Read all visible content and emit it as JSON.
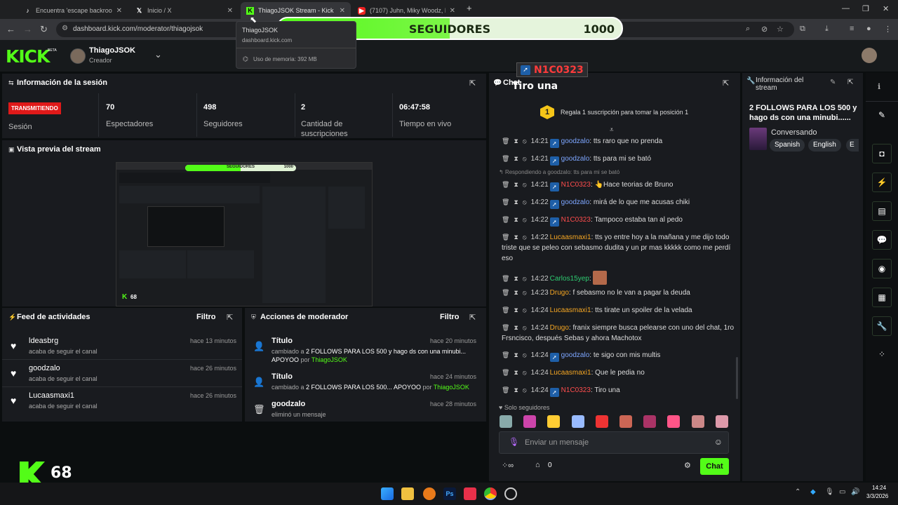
{
  "browser": {
    "tabs": [
      {
        "title": "Encuentra 'escape backrooms' e",
        "icon": "tiktok-icon"
      },
      {
        "title": "Inicio / X",
        "icon": "x-icon"
      },
      {
        "title": "ThiagoJSOK Stream - Kick Dash",
        "icon": "kick-icon"
      },
      {
        "title": "(7107) Juhn, Miky Woodz, B",
        "icon": "youtube-icon"
      }
    ],
    "new_tab": "+",
    "url": "dashboard.kick.com/moderator/thiagojsok",
    "tooltip": {
      "title": "ThiagoJSOK",
      "host": "dashboard.kick.com",
      "memory": "Uso de memoria: 392 MB"
    }
  },
  "follower_goal": {
    "current": "499",
    "label": "SEGUIDORES",
    "goal": "1000",
    "progress": 0.499
  },
  "header": {
    "logo": "KICK",
    "beta": "BETA",
    "username": "ThiagoJSOK",
    "role": "Creador"
  },
  "session": {
    "title": "Información de la sesión",
    "status": "TRANSMITIENDO",
    "status_label": "Sesión",
    "stats": [
      {
        "value": "70",
        "label": "Espectadores"
      },
      {
        "value": "498",
        "label": "Seguidores"
      },
      {
        "value": "2",
        "label": "Cantidad de suscripciones"
      },
      {
        "value": "06:47:58",
        "label": "Tiempo en vivo"
      }
    ]
  },
  "preview": {
    "title": "Vista previa del stream",
    "progress_label": "SEGUIDORES",
    "progress_goal": "1000",
    "logo_text": "68"
  },
  "feed": {
    "title": "Feed de actividades",
    "filter": "Filtro",
    "items": [
      {
        "name": "ldeasbrg",
        "action": "acaba de seguir el canal",
        "time": "hace 13 minutos"
      },
      {
        "name": "goodzalo",
        "action": "acaba de seguir el canal",
        "time": "hace 26 minutos"
      },
      {
        "name": "Lucaasmaxi1",
        "action": "acaba de seguir el canal",
        "time": "hace 26 minutos"
      }
    ]
  },
  "mod": {
    "title": "Acciones de moderador",
    "filter": "Filtro",
    "items": [
      {
        "title": "Título",
        "time": "hace 20 minutos",
        "pre": "cambiado a ",
        "value": "2 FOLLOWS PARA LOS 500 y hago ds con una minubi...",
        "mid": "APOYOO",
        "by": " por ",
        "user": "ThiagoJSOK"
      },
      {
        "title": "Título",
        "time": "hace 24 minutos",
        "pre": "cambiado a ",
        "value": "2 FOLLOWS PARA LOS 500...",
        "mid": "APOYOO",
        "by": " por ",
        "user": "ThiagoJSOK"
      },
      {
        "title": "goodzalo",
        "time": "hace 28 minutos",
        "pre": "eliminó un mensaje",
        "value": "",
        "mid": "",
        "by": "",
        "user": ""
      }
    ]
  },
  "chat": {
    "title": "Chat",
    "pinned": {
      "rank": "1",
      "text": "Regala 1 suscripción para tomar la posición 1"
    },
    "reply_context": "Respondiendo a goodzalo: tts para mi se bató",
    "messages": [
      {
        "time": "14:21",
        "user": "goodzalo",
        "color": "blue",
        "badge": true,
        "text": "tts raro que no prenda"
      },
      {
        "time": "14:21",
        "user": "goodzalo",
        "color": "blue",
        "badge": true,
        "text": "tts para mi se bató"
      },
      {
        "time": "14:21",
        "user": "N1C0323",
        "color": "red",
        "badge": true,
        "text": "👆Hace teorias de Bruno"
      },
      {
        "time": "14:22",
        "user": "goodzalo",
        "color": "blue",
        "badge": true,
        "text": "mirá de lo que me acusas chiki"
      },
      {
        "time": "14:22",
        "user": "N1C0323",
        "color": "red",
        "badge": true,
        "text": "Tampoco estaba tan al pedo"
      },
      {
        "time": "14:22",
        "user": "Lucaasmaxi1",
        "color": "orange",
        "badge": false,
        "text": "tts yo entre hoy a la mañana y me dijo todo triste que se peleo con sebasmo dudita y un pr mas kkkkk como me perdí eso"
      },
      {
        "time": "14:22",
        "user": "Carlos15yep",
        "color": "green",
        "badge": false,
        "text": ""
      },
      {
        "time": "14:23",
        "user": "Drugo",
        "color": "orange",
        "badge": false,
        "text": "f sebasmo no le van a pagar la deuda"
      },
      {
        "time": "14:24",
        "user": "Lucaasmaxi1",
        "color": "orange",
        "badge": false,
        "text": "tts tirate un spoiler de la velada"
      },
      {
        "time": "14:24",
        "user": "Drugo",
        "color": "orange",
        "badge": false,
        "text": "franix siempre busca pelearse con uno del chat, 1ro Frsncisco, después Sebas y ahora Machotox"
      },
      {
        "time": "14:24",
        "user": "goodzalo",
        "color": "blue",
        "badge": true,
        "text": "te sigo con mis multis"
      },
      {
        "time": "14:24",
        "user": "Lucaasmaxi1",
        "color": "orange",
        "badge": false,
        "text": "Que le pedia no"
      },
      {
        "time": "14:24",
        "user": "N1C0323",
        "color": "red",
        "badge": true,
        "text": "Tiro una"
      }
    ],
    "followers_only": "Solo seguidores",
    "input_placeholder": "Enviar un mensaje",
    "points": "0",
    "send": "Chat",
    "emotes": [
      "#8aa",
      "#c4a",
      "#fc3",
      "#9bf",
      "#e33",
      "#c65",
      "#a36",
      "#f58",
      "#c88",
      "#d9a"
    ]
  },
  "overlay": {
    "name": "N1C0323",
    "message": "Tiro una"
  },
  "stream_info": {
    "title": "Información del stream",
    "stream_title": "2 FOLLOWS PARA LOS 500 y hago ds con una minubi......",
    "category": "Conversando",
    "tags": [
      "Spanish",
      "English",
      "E"
    ]
  },
  "taskbar": {
    "time": "14:24",
    "date": "3/3/2026"
  },
  "corner_logo": {
    "letter": "K",
    "number": "68"
  }
}
